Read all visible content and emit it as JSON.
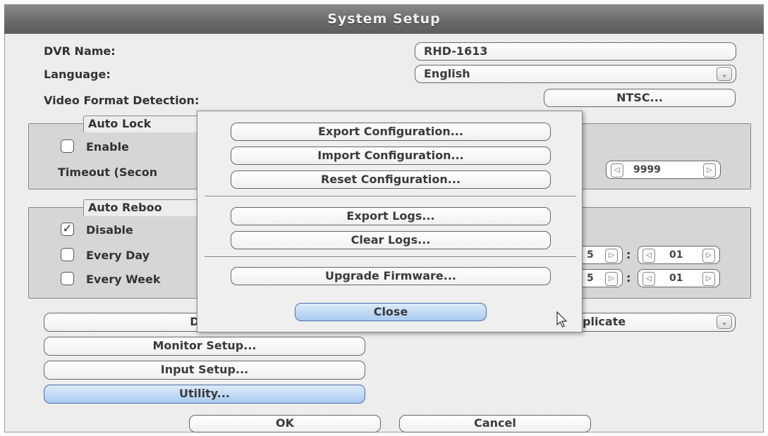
{
  "window": {
    "title": "System Setup"
  },
  "fields": {
    "dvr_name_label": "DVR Name:",
    "dvr_name_value": "RHD-1613",
    "language_label": "Language:",
    "language_value": "English",
    "video_format_label": "Video Format Detection:",
    "video_format_button": "NTSC..."
  },
  "auto_lock": {
    "title": "Auto Lock",
    "enable_label": "Enable",
    "enable_checked": false,
    "timeout_label": "Timeout (Secon",
    "timeout_value": "9999"
  },
  "auto_reboot": {
    "title": "Auto Reboo",
    "options": [
      {
        "label": "Disable",
        "checked": true
      },
      {
        "label": "Every Day",
        "checked": false
      },
      {
        "label": "Every Week",
        "checked": false
      }
    ],
    "day_hour_fragment": "5",
    "day_minute": "01",
    "week_hour_fragment": "5",
    "week_minute": "01",
    "time_separator": ":"
  },
  "buttons": {
    "date_time": "Date/Tim",
    "duplicate_fragment": "plicate",
    "monitor_setup": "Monitor Setup...",
    "input_setup": "Input Setup...",
    "utility": "Utility...",
    "ok": "OK",
    "cancel": "Cancel"
  },
  "utility_popup": {
    "export_config": "Export Configuration...",
    "import_config": "Import Configuration...",
    "reset_config": "Reset Configuration...",
    "export_logs": "Export Logs...",
    "clear_logs": "Clear Logs...",
    "upgrade_firmware": "Upgrade Firmware...",
    "close": "Close"
  },
  "icons": {
    "check": "✓",
    "dropdown": "⌄",
    "spin_left": "◁",
    "spin_right": "▷",
    "cursor": "mouse-cursor-icon"
  },
  "colors": {
    "titlebar": "#6b6b6b",
    "highlight_button": "#a9cbf0",
    "group_background": "#d6d6d6"
  }
}
